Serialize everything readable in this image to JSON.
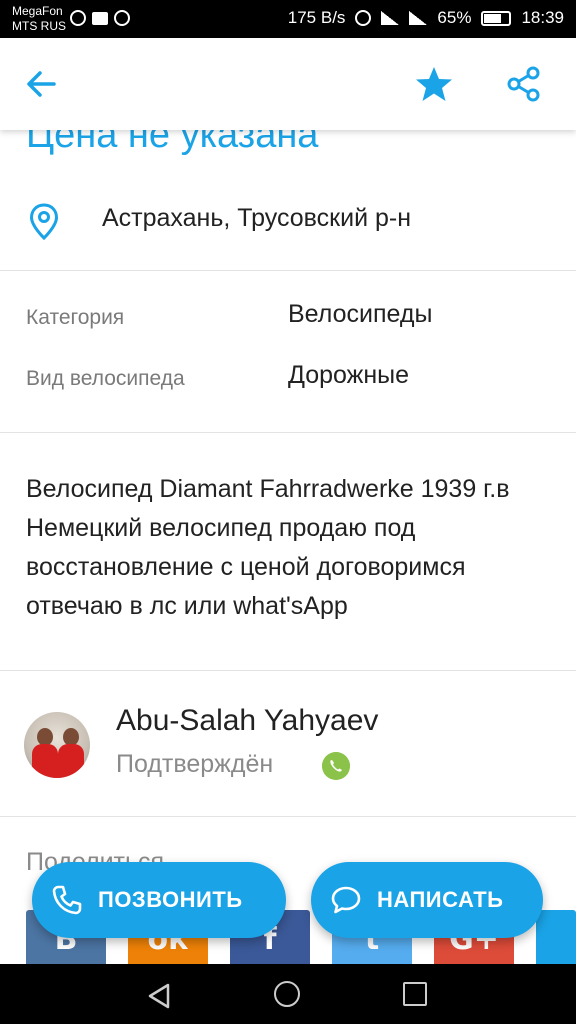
{
  "status_bar": {
    "carrier1": "MegaFon",
    "carrier2": "MTS RUS",
    "speed": "175 B/s",
    "battery": "65%",
    "time": "18:39"
  },
  "app_bar": {
    "icons": [
      "arrow-back-icon",
      "star-icon",
      "share-icon"
    ]
  },
  "listing": {
    "price": "Цена не указана",
    "location": "Астрахань, Трусовский р-н",
    "attributes": [
      {
        "label": "Категория",
        "value": "Велосипеды"
      },
      {
        "label": "Вид велосипеда",
        "value": "Дорожные"
      }
    ],
    "description": "Велосипед Diamant Fahrradwerke 1939 г.в Немецкий велосипед продаю под восстановление с ценой договоримся отвечаю в лс или what'sApp"
  },
  "seller": {
    "name": "Abu-Salah Yahyaev",
    "status": "Подтверждён"
  },
  "share": {
    "title": "Поделиться",
    "networks": [
      {
        "name": "vk",
        "glyph": "В",
        "color": "#4c75a3"
      },
      {
        "name": "odnoklassniki",
        "glyph": "ок",
        "color": "#ee8208"
      },
      {
        "name": "facebook",
        "glyph": "f",
        "color": "#3b5998"
      },
      {
        "name": "twitter",
        "glyph": "t",
        "color": "#55acee"
      },
      {
        "name": "google-plus",
        "glyph": "G+",
        "color": "#dd4b39"
      }
    ]
  },
  "actions": {
    "call_label": "ПОЗВОНИТЬ",
    "message_label": "НАПИСАТЬ"
  },
  "colors": {
    "accent": "#1aa3e6",
    "whatsapp": "#8bc34a"
  }
}
